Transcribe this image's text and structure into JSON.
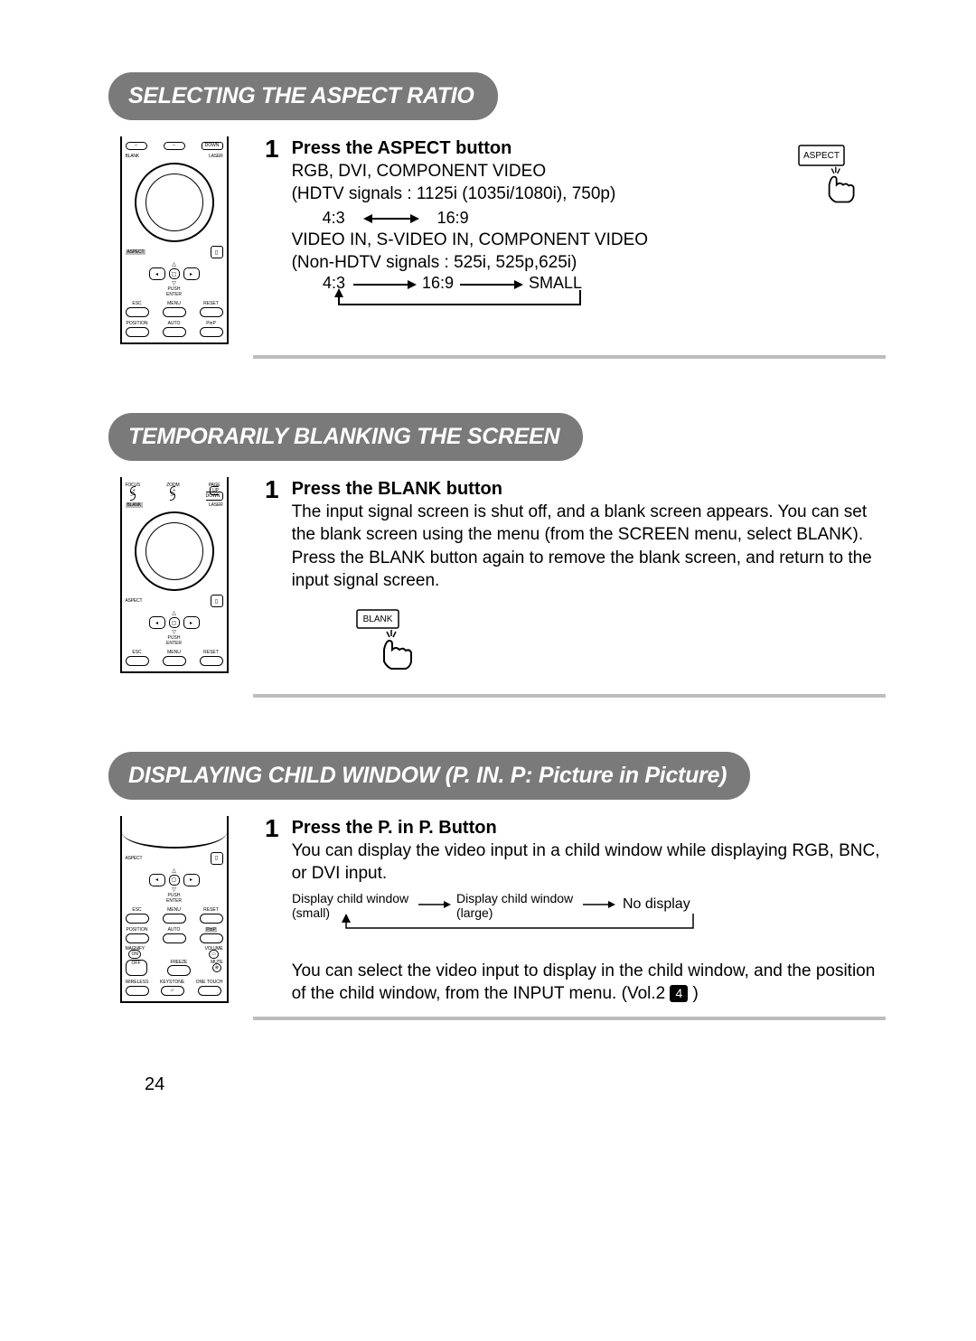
{
  "sections": {
    "aspect": {
      "title": "SELECTING THE ASPECT RATIO",
      "step_number": "1",
      "step_title": "Press the ASPECT button",
      "line_rgb": "RGB, DVI, COMPONENT VIDEO",
      "line_hdtv": "(HDTV signals : 1125i (1035i/1080i), 750p)",
      "ratio_43": "4:3",
      "ratio_169": "16:9",
      "line_video": "VIDEO IN, S-VIDEO IN, COMPONENT VIDEO",
      "line_nonhdtv": "(Non-HDTV signals : 525i, 525p,625i)",
      "flow_43": "4:3",
      "flow_169": "16:9",
      "flow_small": "SMALL",
      "aspect_label": "ASPECT"
    },
    "blank": {
      "title": "TEMPORARILY BLANKING THE SCREEN",
      "step_number": "1",
      "step_title": "Press the BLANK button",
      "body": "The input signal screen is shut off, and a blank screen appears. You can set the blank screen using the menu (from the SCREEN menu, select BLANK). Press the BLANK button again to remove the blank screen, and return to the input signal screen.",
      "blank_label": "BLANK"
    },
    "pinp": {
      "title": "DISPLAYING CHILD WINDOW (P. IN. P: Picture in Picture)",
      "step_number": "1",
      "step_title": "Press the P. in P. Button",
      "intro": "You can display the video input in a child window while displaying RGB, BNC, or DVI input.",
      "flow_a_top": "Display child window",
      "flow_a_bot": "(small)",
      "flow_b_top": "Display child window",
      "flow_b_bot": "(large)",
      "flow_c": "No display",
      "body2a": "You can select the video input to display in the child window, and the position of the child window, from the INPUT menu. (Vol.2 ",
      "body2_num": "4",
      "body2b": " )"
    }
  },
  "remote_labels": {
    "down": "DOWN",
    "blank": "BLANK",
    "laser": "LASER",
    "aspect": "ASPECT",
    "push_enter": "PUSH\nENTER",
    "esc": "ESC",
    "menu": "MENU",
    "reset": "RESET",
    "position": "POSITION",
    "auto": "AUTO",
    "pinp": "PinP",
    "focus": "FOCUS",
    "zoom": "ZOOM",
    "page": "PAGE",
    "up": "UP",
    "magnify": "MAGNIFY",
    "on": "ON",
    "off": "OFF",
    "volume": "VOLUME",
    "freeze": "FREEZE",
    "mute": "MUTE",
    "wireless": "WIRELESS",
    "keystone": "KEYSTONE",
    "one_touch": "ONE TOUCH"
  },
  "page_number": "24"
}
